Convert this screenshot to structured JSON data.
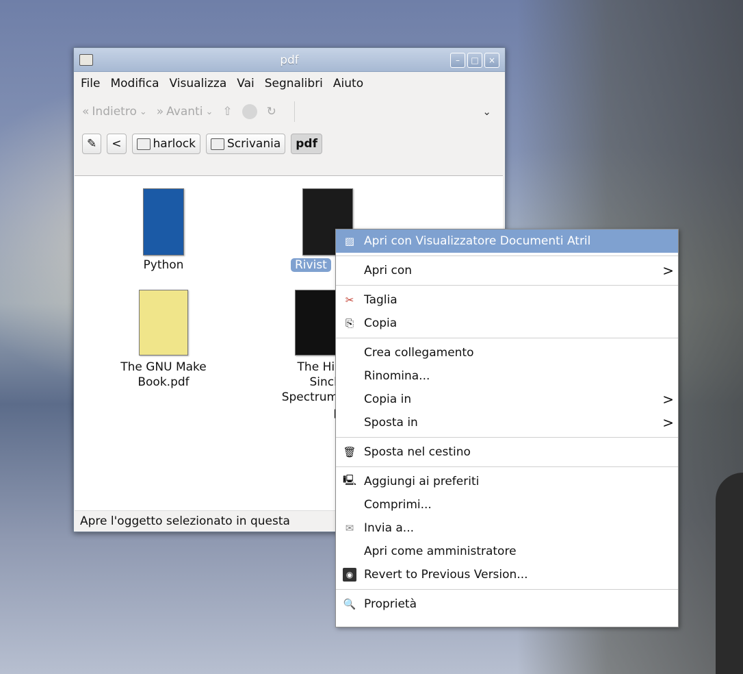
{
  "window": {
    "title": "pdf",
    "menu": [
      "File",
      "Modifica",
      "Visualizza",
      "Vai",
      "Segnalibri",
      "Aiuto"
    ],
    "toolbar": {
      "back": "Indietro",
      "forward": "Avanti"
    },
    "path": {
      "back_glyph": "<",
      "crumbs": [
        "harlock",
        "Scrivania",
        "pdf"
      ]
    },
    "files": [
      {
        "name": "Python",
        "thumb_color": "#1b5aa6"
      },
      {
        "name": "Rivist",
        "thumb_color": "#1b1b1b"
      },
      {
        "name": "The GNU Make Book.pdf",
        "line1": "The GNU Make",
        "line2": "Book.pdf",
        "thumb_color": "#f0e58a"
      },
      {
        "line1": "The Histo",
        "line2": "Sinclair",
        "line3": "Spectrum in",
        "line4": "pdf",
        "thumb_color": "#111111"
      }
    ],
    "status": "Apre l'oggetto selezionato in questa"
  },
  "context_menu": {
    "items": [
      {
        "label": "Apri con Visualizzatore Documenti Atril",
        "icon": "atril-icon",
        "highlighted": true
      },
      {
        "label": "Apri con",
        "submenu": true
      },
      {
        "label": "Taglia",
        "icon": "scissors-icon"
      },
      {
        "label": "Copia",
        "icon": "copy-icon"
      },
      {
        "label": "Crea collegamento"
      },
      {
        "label": "Rinomina..."
      },
      {
        "label": "Copia in",
        "submenu": true
      },
      {
        "label": "Sposta in",
        "submenu": true
      },
      {
        "label": "Sposta nel cestino",
        "icon": "trash-icon"
      },
      {
        "label": "Aggiungi ai preferiti",
        "icon": "computer-icon"
      },
      {
        "label": "Comprimi..."
      },
      {
        "label": "Invia a...",
        "icon": "send-icon"
      },
      {
        "label": "Apri come amministratore"
      },
      {
        "label": "Revert to Previous Version...",
        "icon": "revert-icon"
      },
      {
        "label": "Proprietà",
        "icon": "properties-icon"
      }
    ],
    "submenu_glyph": ">"
  }
}
